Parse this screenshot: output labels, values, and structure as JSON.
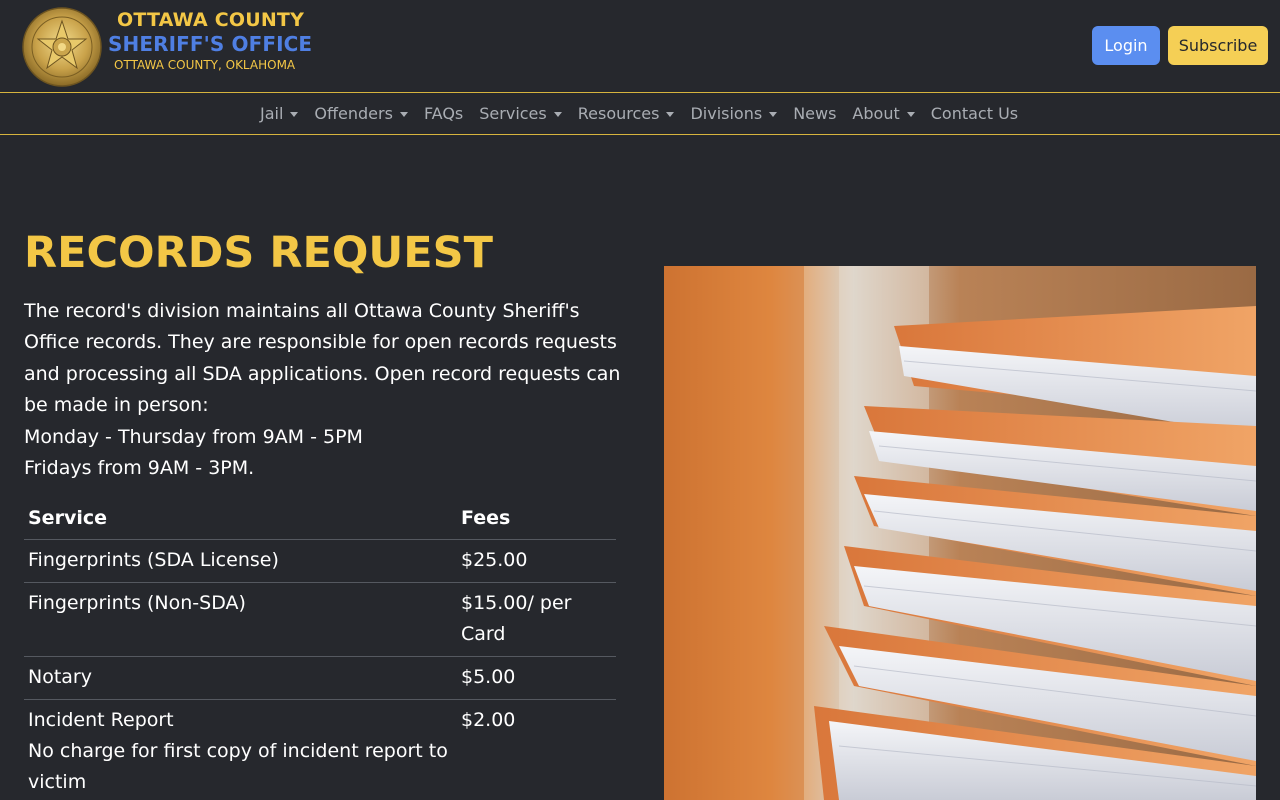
{
  "header": {
    "brand_line1": "OTTAWA COUNTY",
    "brand_line2": "SHERIFF'S OFFICE",
    "brand_line3": "OTTAWA COUNTY, OKLAHOMA",
    "login_label": "Login",
    "subscribe_label": "Subscribe"
  },
  "nav": {
    "items": [
      {
        "label": "Jail",
        "dropdown": true
      },
      {
        "label": "Offenders",
        "dropdown": true
      },
      {
        "label": "FAQs",
        "dropdown": false
      },
      {
        "label": "Services",
        "dropdown": true
      },
      {
        "label": "Resources",
        "dropdown": true
      },
      {
        "label": "Divisions",
        "dropdown": true
      },
      {
        "label": "News",
        "dropdown": false
      },
      {
        "label": "About",
        "dropdown": true
      },
      {
        "label": "Contact Us",
        "dropdown": false
      }
    ]
  },
  "main": {
    "title": "RECORDS REQUEST",
    "intro": "The record's division maintains all Ottawa County Sheriff's Office records. They are responsible for open records requests and processing all SDA applications. Open record requests can be made in person:",
    "hours_line1": "Monday - Thursday from 9AM - 5PM",
    "hours_line2": "Fridays from 9AM - 3PM.",
    "table": {
      "headers": [
        "Service",
        "Fees"
      ],
      "rows": [
        {
          "service": "Fingerprints (SDA License)",
          "note": "",
          "fee": "$25.00"
        },
        {
          "service": "Fingerprints (Non-SDA)",
          "note": "",
          "fee": "$15.00/ per Card"
        },
        {
          "service": "Notary",
          "note": "",
          "fee": "$5.00"
        },
        {
          "service": "Incident Report",
          "note": "No charge for first copy of incident report to victim",
          "fee": "$2.00"
        }
      ]
    }
  },
  "colors": {
    "background": "#26282d",
    "accent_gold": "#f3c746",
    "brand_blue": "#4f7fe3",
    "login_blue": "#5b8ef0",
    "subscribe_yellow": "#f5cf55",
    "nav_text": "#a9adb3"
  },
  "icons": {
    "badge": "sheriff-star-badge-icon",
    "caret": "caret-down-icon"
  }
}
